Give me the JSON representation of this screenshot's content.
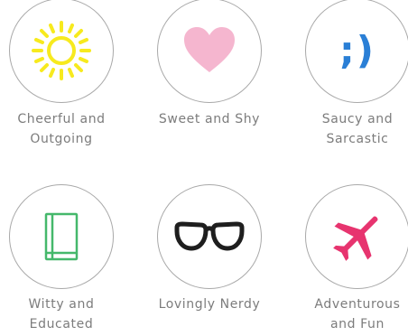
{
  "tiles": [
    {
      "id": "cheerful",
      "icon": "sun-icon",
      "line1": "Cheerful and",
      "line2": "Outgoing"
    },
    {
      "id": "sweet",
      "icon": "heart-icon",
      "line1": "Sweet and Shy",
      "line2": ""
    },
    {
      "id": "saucy",
      "icon": "wink-emoticon-icon",
      "glyph": ";)",
      "line1": "Saucy and",
      "line2": "Sarcastic"
    },
    {
      "id": "witty",
      "icon": "book-icon",
      "line1": "Witty and",
      "line2": "Educated"
    },
    {
      "id": "nerdy",
      "icon": "glasses-icon",
      "line1": "Lovingly Nerdy",
      "line2": ""
    },
    {
      "id": "adventurous",
      "icon": "airplane-icon",
      "line1": "Adventurous",
      "line2": "and Fun"
    }
  ],
  "colors": {
    "sun": "#f7ea1e",
    "heart": "#f5b6cf",
    "wink": "#2a7fd6",
    "book": "#45b86b",
    "glasses": "#1e1e1e",
    "plane": "#e7346f",
    "circle_border": "#a9a9a9",
    "text": "#7c7c7c"
  }
}
